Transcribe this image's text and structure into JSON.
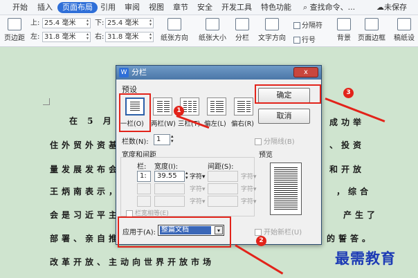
{
  "ribbon_tabs": [
    "开始",
    "插入",
    "页面布局",
    "引用",
    "审阅",
    "视图",
    "章节",
    "安全",
    "开发工具",
    "特色功能"
  ],
  "ribbon_search": "查找命令、...",
  "ribbon_unsaved": "未保存",
  "ribbon": {
    "margin_label": "页边距",
    "top_label": "上:",
    "top_value": "25.4 毫米",
    "bottom_label": "下:",
    "bottom_value": "25.4 毫米",
    "left_label": "左:",
    "left_value": "31.8 毫米",
    "right_label": "右:",
    "right_value": "31.8 毫米",
    "orientation": "纸张方向",
    "size": "纸张大小",
    "columns": "分栏",
    "direction": "文字方向",
    "separator": "分隔符",
    "lines": "行号",
    "background": "背景",
    "border": "页面边框",
    "draft": "稿纸设"
  },
  "document_lines": [
    "在 5 月 1 8 日",
    "住外贸外资基",
    "量发展发布会",
    "王炳南表示，",
    "会是习近平主",
    "部署、亲自推",
    "改革开放、主动向世界开放市场"
  ],
  "document_right_fragments": [
    "成功举",
    "、投资",
    "和开放",
    "，综合",
    "产生了",
    "的誓答。"
  ],
  "dialog": {
    "title": "分栏",
    "close": "x",
    "presets_label": "预设",
    "presets": [
      "一栏(O)",
      "两栏(W)",
      "三栏(T)",
      "偏左(L)",
      "偏右(R)"
    ],
    "ok": "确定",
    "cancel": "取消",
    "num_cols_label": "栏数(N):",
    "num_cols_value": "1",
    "separator_label": "分隔线(B)",
    "width_spacing_label": "宽度和间距",
    "col_header": "栏:",
    "width_header": "宽度(I):",
    "spacing_header": "间距(S):",
    "col_index": "1:",
    "width_value": "39.55",
    "unit_char": "字符",
    "equal_width_label": "栏宽相等(E)",
    "preview_label": "预览",
    "apply_label": "应用于(A):",
    "apply_value": "整篇文档",
    "new_col_label": "开始新栏(U)"
  },
  "badges": [
    "1",
    "2",
    "3"
  ],
  "watermark": "最需教育"
}
